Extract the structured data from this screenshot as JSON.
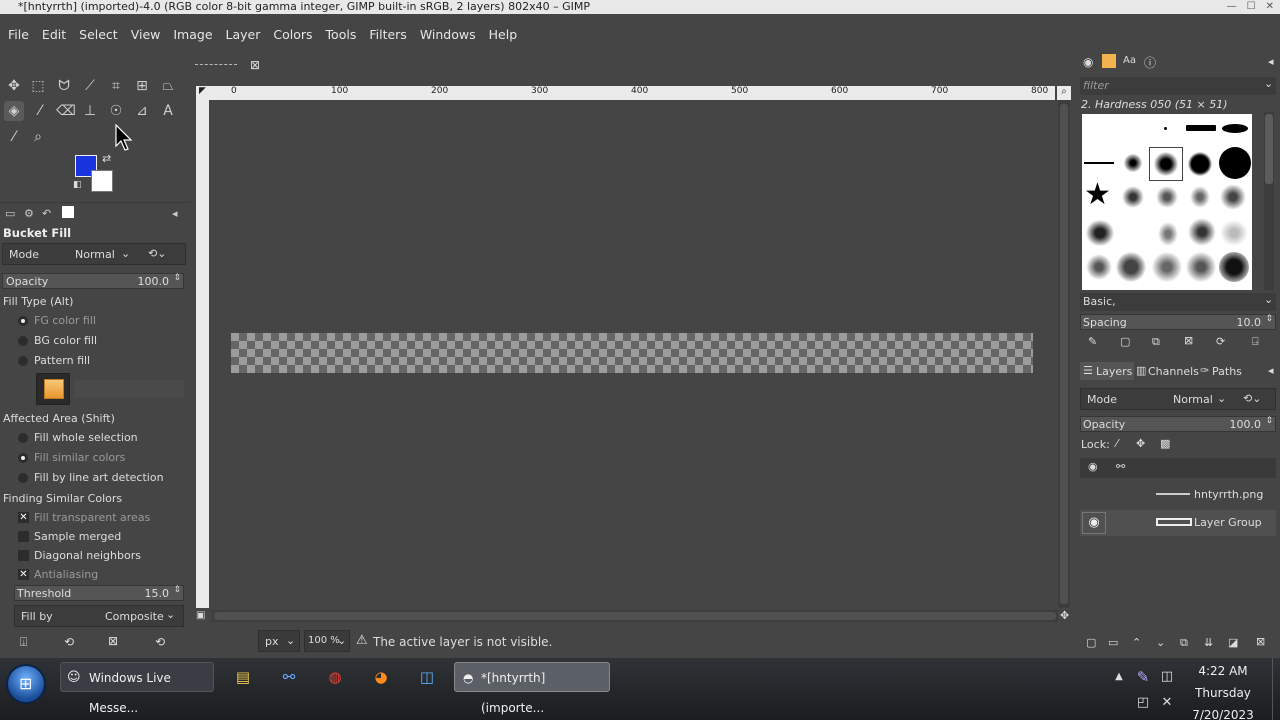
{
  "window": {
    "title": "*[hntyrrth] (imported)-4.0 (RGB color 8-bit gamma integer, GIMP built-in sRGB, 2 layers) 802x40 – GIMP"
  },
  "menu": [
    "File",
    "Edit",
    "Select",
    "View",
    "Image",
    "Layer",
    "Colors",
    "Tools",
    "Filters",
    "Windows",
    "Help"
  ],
  "tool_options": {
    "tool_name": "Bucket Fill",
    "mode_label": "Mode",
    "mode_value": "Normal",
    "opacity_label": "Opacity",
    "opacity_value": "100.0",
    "fill_type_label": "Fill Type  (Alt)",
    "fill_types": [
      "FG color fill",
      "BG color fill",
      "Pattern fill"
    ],
    "affected_area_label": "Affected Area  (Shift)",
    "affected_areas": [
      "Fill whole selection",
      "Fill similar colors",
      "Fill by line art detection"
    ],
    "finding_label": "Finding Similar Colors",
    "checks": [
      "Fill transparent areas",
      "Sample merged",
      "Diagonal neighbors",
      "Antialiasing"
    ],
    "threshold_label": "Threshold",
    "threshold_value": "15.0",
    "fill_by_label": "Fill by",
    "fill_by_value": "Composite"
  },
  "rulers": {
    "h_ticks": [
      "0",
      "100",
      "200",
      "300",
      "400",
      "500",
      "600",
      "700",
      "800"
    ]
  },
  "status": {
    "unit": "px",
    "zoom": "100 %",
    "message": "The active layer is not visible."
  },
  "brushes": {
    "filter_placeholder": "filter",
    "current_brush": "2. Hardness 050 (51 × 51)",
    "tag": "Basic,",
    "spacing_label": "Spacing",
    "spacing_value": "10.0"
  },
  "layers": {
    "tabs": [
      "Layers",
      "Channels",
      "Paths"
    ],
    "mode_label": "Mode",
    "mode_value": "Normal",
    "opacity_label": "Opacity",
    "opacity_value": "100.0",
    "lock_label": "Lock:",
    "items": [
      {
        "name": "hntyrrth.png",
        "visible": false
      },
      {
        "name": "Layer Group",
        "visible": true
      }
    ]
  },
  "taskbar": {
    "items": [
      "Windows Live Messe...",
      "*[hntyrrth] (importe..."
    ],
    "time": "4:22 AM",
    "day": "Thursday",
    "date": "7/20/2023"
  }
}
